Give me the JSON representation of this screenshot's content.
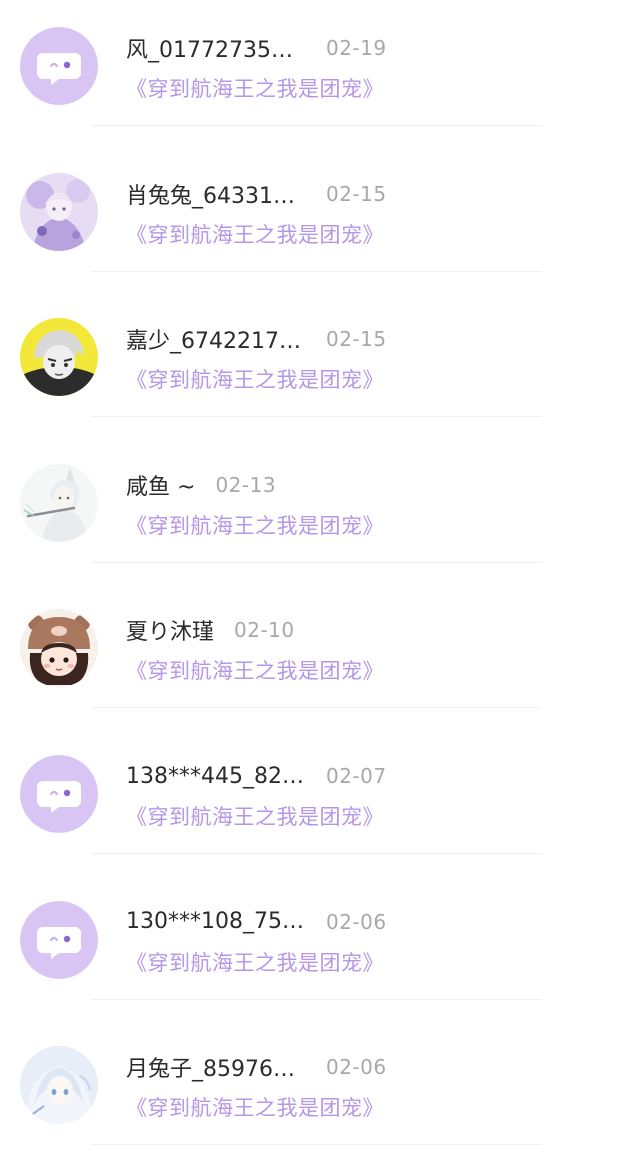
{
  "comments": [
    {
      "name": "风_01772735…",
      "date": "02-19",
      "book": "《穿到航海王之我是团宠》",
      "avatar": "default-chat-icon",
      "truncated": true
    },
    {
      "name": "肖兔兔_64331…",
      "date": "02-15",
      "book": "《穿到航海王之我是团宠》",
      "avatar": "anime-girl-purple",
      "truncated": true
    },
    {
      "name": "嘉少_6742217…",
      "date": "02-15",
      "book": "《穿到航海王之我是团宠》",
      "avatar": "anime-boy-yellow",
      "truncated": true
    },
    {
      "name": "咸鱼 ~",
      "date": "02-13",
      "book": "《穿到航海王之我是团宠》",
      "avatar": "anime-flute-player",
      "truncated": false
    },
    {
      "name": "夏り沐瑾",
      "date": "02-10",
      "book": "《穿到航海王之我是团宠》",
      "avatar": "cartoon-girl-bear-hat",
      "truncated": false
    },
    {
      "name": "138***445_82…",
      "date": "02-07",
      "book": "《穿到航海王之我是团宠》",
      "avatar": "default-chat-icon",
      "truncated": true
    },
    {
      "name": "130***108_75…",
      "date": "02-06",
      "book": "《穿到航海王之我是团宠》",
      "avatar": "default-chat-icon",
      "truncated": true
    },
    {
      "name": "月兔子_85976…",
      "date": "02-06",
      "book": "《穿到航海王之我是团宠》",
      "avatar": "anime-girl-white-hair",
      "truncated": true
    }
  ],
  "colors": {
    "accent": "#b596e8",
    "default_avatar_bg": "#d8c5f4",
    "name": "#2b2b2b",
    "date": "#a8a8a8"
  }
}
